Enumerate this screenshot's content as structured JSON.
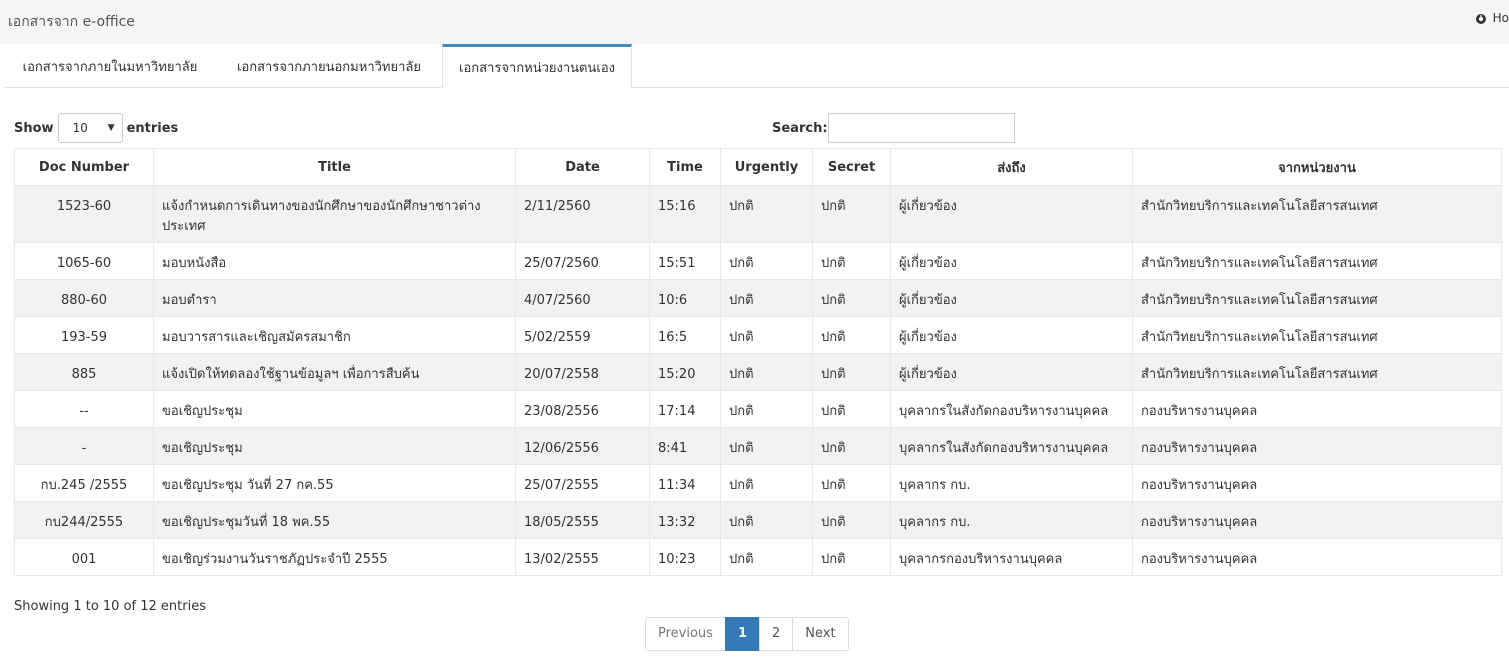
{
  "header": {
    "title": "เอกสารจาก e-office",
    "home_label": "Ho"
  },
  "tabs": [
    {
      "label": "เอกสารจากภายในมหาวิทยาลัย",
      "active": false
    },
    {
      "label": "เอกสารจากภายนอกมหาวิทยาลัย",
      "active": false
    },
    {
      "label": "เอกสารจากหน่วยงานตนเอง",
      "active": true
    }
  ],
  "controls": {
    "show_label": "Show",
    "entries_label": "entries",
    "page_size": "10",
    "search_label": "Search:",
    "search_value": ""
  },
  "table": {
    "columns": [
      "Doc Number",
      "Title",
      "Date",
      "Time",
      "Urgently",
      "Secret",
      "ส่งถึง",
      "จากหน่วยงาน"
    ],
    "rows": [
      [
        "1523-60",
        "แจ้งกำหนดการเดินทางของนักศึกษาของนักศึกษาชาวต่างประเทศ",
        "2/11/2560",
        "15:16",
        "ปกติ",
        "ปกติ",
        "ผู้เกี่ยวข้อง",
        "สำนักวิทยบริการและเทคโนโลยีสารสนเทศ"
      ],
      [
        "1065-60",
        "มอบหนังสือ",
        "25/07/2560",
        "15:51",
        "ปกติ",
        "ปกติ",
        "ผู้เกี่ยวข้อง",
        "สำนักวิทยบริการและเทคโนโลยีสารสนเทศ"
      ],
      [
        "880-60",
        "มอบตำรา",
        "4/07/2560",
        "10:6",
        "ปกติ",
        "ปกติ",
        "ผู้เกี่ยวข้อง",
        "สำนักวิทยบริการและเทคโนโลยีสารสนเทศ"
      ],
      [
        "193-59",
        "มอบวารสารและเชิญสมัครสมาชิก",
        "5/02/2559",
        "16:5",
        "ปกติ",
        "ปกติ",
        "ผู้เกี่ยวข้อง",
        "สำนักวิทยบริการและเทคโนโลยีสารสนเทศ"
      ],
      [
        "885",
        "แจ้งเปิดให้ทดลองใช้ฐานข้อมูลฯ เพื่อการสืบค้น",
        "20/07/2558",
        "15:20",
        "ปกติ",
        "ปกติ",
        "ผู้เกี่ยวข้อง",
        "สำนักวิทยบริการและเทคโนโลยีสารสนเทศ"
      ],
      [
        "--",
        "ขอเชิญประชุม",
        "23/08/2556",
        "17:14",
        "ปกติ",
        "ปกติ",
        "บุคลากรในสังกัดกองบริหารงานบุคคล",
        "กองบริหารงานบุคคล"
      ],
      [
        "-",
        "ขอเชิญประชุม",
        "12/06/2556",
        "8:41",
        "ปกติ",
        "ปกติ",
        "บุคลากรในสังกัดกองบริหารงานบุคคล",
        "กองบริหารงานบุคคล"
      ],
      [
        "กบ.245 /2555",
        "ขอเชิญประชุม วันที่ 27 กค.55",
        "25/07/2555",
        "11:34",
        "ปกติ",
        "ปกติ",
        "บุคลากร กบ.",
        "กองบริหารงานบุคคล"
      ],
      [
        "กบ244/2555",
        "ขอเชิญประชุมวันที่ 18 พค.55",
        "18/05/2555",
        "13:32",
        "ปกติ",
        "ปกติ",
        "บุคลากร กบ.",
        "กองบริหารงานบุคคล"
      ],
      [
        "001",
        "ขอเชิญร่วมงานวันราชภัฏประจำปี 2555",
        "13/02/2555",
        "10:23",
        "ปกติ",
        "ปกติ",
        "บุคลากรกองบริหารงานบุคคล",
        "กองบริหารงานบุคคล"
      ]
    ]
  },
  "footer": {
    "info": "Showing 1 to 10 of 12 entries",
    "pagination": {
      "previous": "Previous",
      "pages": [
        "1",
        "2"
      ],
      "current": "1",
      "next": "Next"
    }
  },
  "colors": {
    "accent": "#337ab7",
    "tab_accent": "#3c8dbc",
    "stripe": "#f2f2f2"
  }
}
